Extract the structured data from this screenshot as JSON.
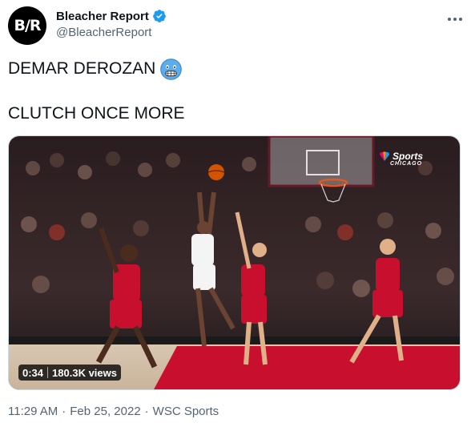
{
  "author": {
    "avatar_text": "B/R",
    "display_name": "Bleacher Report",
    "handle": "@BleacherReport",
    "verified": true
  },
  "more_icon": "more-horizontal-icon",
  "tweet": {
    "line1": "DEMAR DEROZAN",
    "line1_emoji": "cold-face-emoji",
    "line2": "CLUTCH ONCE MORE"
  },
  "media": {
    "type": "video",
    "duration": "0:34",
    "views": "180.3K views",
    "broadcaster": "Sports",
    "broadcaster_city": "CHICAGO"
  },
  "meta": {
    "time": "11:29 AM",
    "separator1": "·",
    "date": "Feb 25, 2022",
    "separator2": "·",
    "source": "WSC Sports"
  },
  "colors": {
    "verified_blue": "#1d9bf0",
    "secondary_text": "#536471",
    "primary_text": "#0f1419",
    "court_red": "#c8102e"
  }
}
